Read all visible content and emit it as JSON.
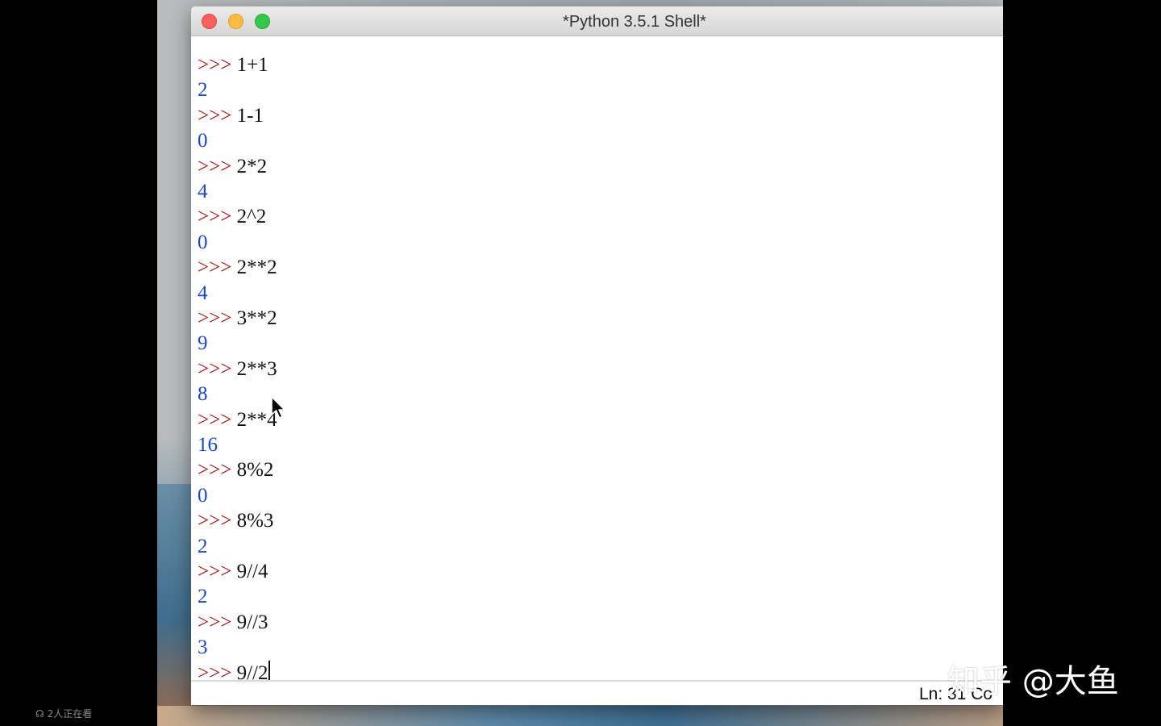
{
  "window": {
    "title": "*Python 3.5.1 Shell*"
  },
  "shell": {
    "prompt": ">>>",
    "lines": [
      {
        "type": "input",
        "text": "1+1"
      },
      {
        "type": "output",
        "text": "2"
      },
      {
        "type": "input",
        "text": "1-1"
      },
      {
        "type": "output",
        "text": "0"
      },
      {
        "type": "input",
        "text": "2*2"
      },
      {
        "type": "output",
        "text": "4"
      },
      {
        "type": "input",
        "text": "2^2"
      },
      {
        "type": "output",
        "text": "0"
      },
      {
        "type": "input",
        "text": "2**2"
      },
      {
        "type": "output",
        "text": "4"
      },
      {
        "type": "input",
        "text": "3**2"
      },
      {
        "type": "output",
        "text": "9"
      },
      {
        "type": "input",
        "text": "2**3"
      },
      {
        "type": "output",
        "text": "8"
      },
      {
        "type": "input",
        "text": "2**4"
      },
      {
        "type": "output",
        "text": "16"
      },
      {
        "type": "input",
        "text": "8%2"
      },
      {
        "type": "output",
        "text": "0"
      },
      {
        "type": "input",
        "text": "8%3"
      },
      {
        "type": "output",
        "text": "2"
      },
      {
        "type": "input",
        "text": "9//4"
      },
      {
        "type": "output",
        "text": "2"
      },
      {
        "type": "input",
        "text": "9//3"
      },
      {
        "type": "output",
        "text": "3"
      },
      {
        "type": "input",
        "text": "9//2",
        "active": true
      }
    ]
  },
  "statusbar": {
    "position": "Ln: 31  Co"
  },
  "overlay": {
    "watermark": "知乎 @大鱼",
    "viewers": "2人正在看"
  },
  "colors": {
    "prompt": "#a31515",
    "output": "#1b46c9",
    "input": "#111111"
  },
  "icons": [
    "close-button",
    "minimize-button",
    "maximize-button",
    "mouse-pointer-icon",
    "viewers-icon"
  ]
}
